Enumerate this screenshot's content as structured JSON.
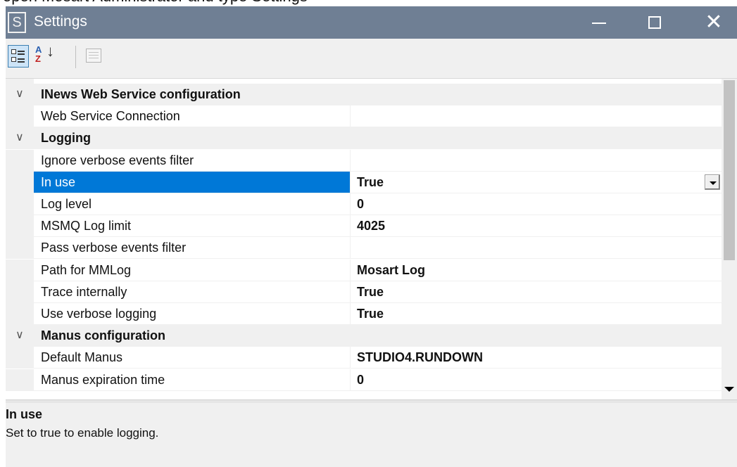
{
  "window": {
    "app_icon_letter": "S",
    "title": "Settings",
    "behind_text": "open Mosart Administrator and type Settings"
  },
  "grid": {
    "rows": [
      {
        "type": "category",
        "name": "INews Web Service configuration"
      },
      {
        "type": "property",
        "name": "Web Service Connection",
        "value": ""
      },
      {
        "type": "category",
        "name": "Logging"
      },
      {
        "type": "property",
        "name": "Ignore verbose events filter",
        "value": ""
      },
      {
        "type": "property",
        "name": "In use",
        "value": "True",
        "selected": true
      },
      {
        "type": "property",
        "name": "Log level",
        "value": "0"
      },
      {
        "type": "property",
        "name": "MSMQ Log limit",
        "value": "4025"
      },
      {
        "type": "property",
        "name": "Pass verbose events filter",
        "value": ""
      },
      {
        "type": "property",
        "name": "Path for MMLog",
        "value": "Mosart Log"
      },
      {
        "type": "property",
        "name": "Trace internally",
        "value": "True"
      },
      {
        "type": "property",
        "name": "Use verbose logging",
        "value": "True"
      },
      {
        "type": "category",
        "name": "Manus configuration"
      },
      {
        "type": "property",
        "name": "Default Manus",
        "value": "STUDIO4.RUNDOWN"
      },
      {
        "type": "property",
        "name": "Manus expiration time",
        "value": "0"
      }
    ]
  },
  "help": {
    "title": "In use",
    "description": "Set to true to enable logging."
  }
}
